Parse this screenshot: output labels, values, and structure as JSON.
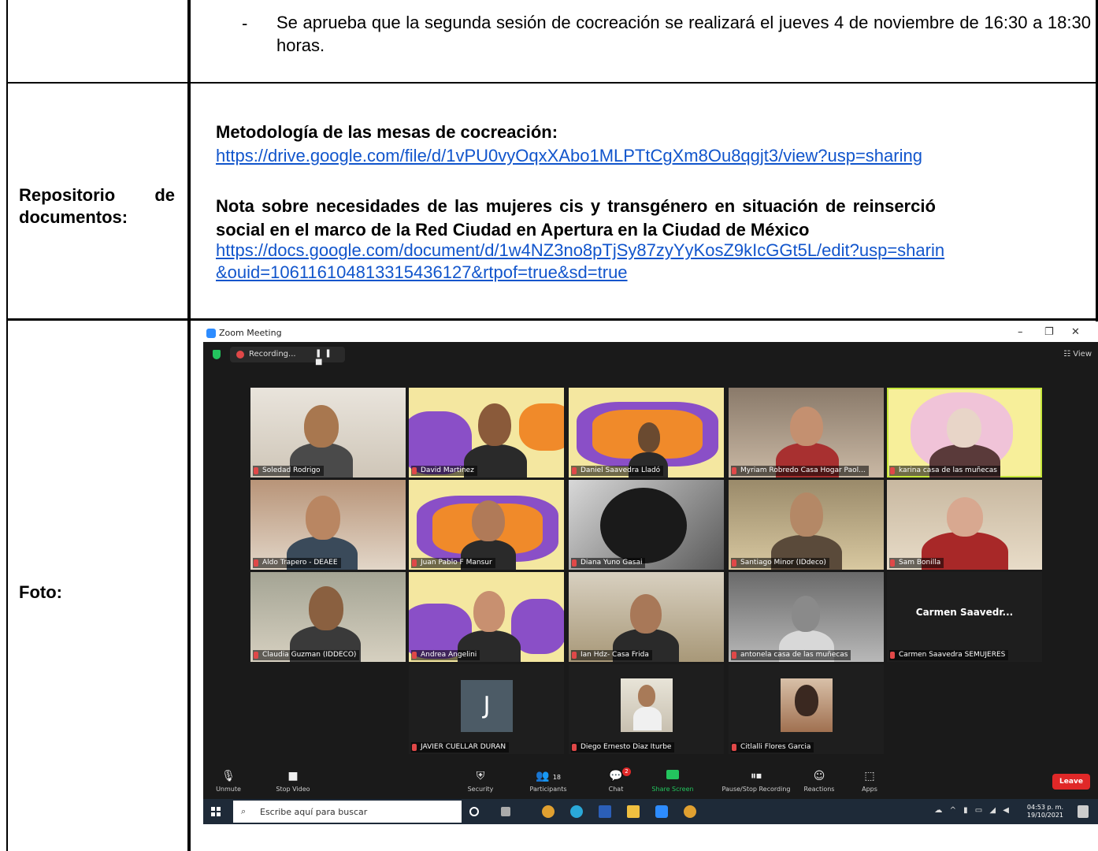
{
  "row1": {
    "bullet": "-",
    "text": "Se aprueba que la segunda sesión de cocreación se realizará el jueves 4 de noviembre de 16:30 a 18:30 horas."
  },
  "row2": {
    "label_line1": "Repositorio de",
    "label_line2": "documentos:",
    "doc1_title": "Metodología de las mesas de cocreación:",
    "doc1_link": "https://drive.google.com/file/d/1vPU0vyOqxXAbo1MLPTtCgXm8Ou8qgjt3/view?usp=sharing",
    "doc2_title_line1": "Nota sobre necesidades de las mujeres cis y transgénero en situación de reinserció",
    "doc2_title_line2": "social en el marco de la Red Ciudad en Apertura en la Ciudad de México",
    "doc2_link_line1": "https://docs.google.com/document/d/1w4NZ3no8pTjSy87zyYyKosZ9kIcGGt5L/edit?usp=sharin",
    "doc2_link_line2": "&ouid=106116104813315436127&rtpof=true&sd=true"
  },
  "row3": {
    "label": "Foto:"
  },
  "zoom": {
    "window_title": "Zoom Meeting",
    "recording_label": "Recording...",
    "recording_controls": "❚❚ ■",
    "view_label": "☷ View",
    "window_controls": [
      "–",
      "❐",
      "✕"
    ],
    "participants": [
      {
        "name": "Soledad Rodrigo"
      },
      {
        "name": "David Martinez"
      },
      {
        "name": "Daniel Saavedra Lladó"
      },
      {
        "name": "Myriam Robredo Casa Hogar Paol..."
      },
      {
        "name": "karina casa de las muñecas"
      },
      {
        "name": "Aldo Trapero - DEAEE"
      },
      {
        "name": "Juan Pablo F Mansur"
      },
      {
        "name": "Diana Yuno Gasai"
      },
      {
        "name": "Santiago Minor (IDdeco)"
      },
      {
        "name": "Sam Bonilla"
      },
      {
        "name": "Claudia Guzman (IDDECO)"
      },
      {
        "name": "Andrea Angelini"
      },
      {
        "name": "Ian Hdz- Casa Frida"
      },
      {
        "name": "antonela casa de las muñecas"
      },
      {
        "name": "Carmen Saavedra SEMUJERES",
        "display": "Carmen Saavedr..."
      },
      {
        "name": "JAVIER CUELLAR DURAN",
        "initial": "J"
      },
      {
        "name": "Diego Ernesto Diaz Iturbe"
      },
      {
        "name": "Citlalli Flores Garcia"
      }
    ],
    "toolbar": {
      "unmute": "Unmute",
      "stop_video": "Stop Video",
      "security": "Security",
      "participants": "Participants",
      "participants_count": "18",
      "chat": "Chat",
      "chat_badge": "2",
      "share_screen": "Share Screen",
      "pause_recording": "Pause/Stop Recording",
      "reactions": "Reactions",
      "apps": "Apps",
      "leave": "Leave"
    },
    "taskbar": {
      "search_placeholder": "Escribe aquí para buscar",
      "time": "04:53 p. m.",
      "date": "19/10/2021"
    }
  }
}
